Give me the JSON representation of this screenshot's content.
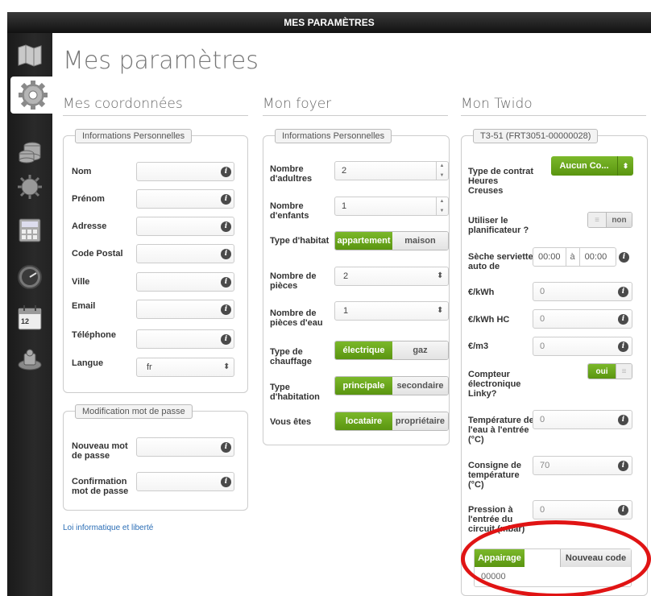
{
  "header": {
    "title": "MES PARAMÈTRES"
  },
  "sidebar": {
    "items": [
      "map-icon",
      "gear-icon",
      "coins-icon",
      "sun-icon",
      "calculator-icon",
      "gauge-icon",
      "calendar-icon",
      "puzzle-icon"
    ],
    "calendar_day": "12"
  },
  "page": {
    "title": "Mes paramètres"
  },
  "columns": {
    "coordonnees": "Mes coordonnées",
    "foyer": "Mon foyer",
    "twido": "Mon Twido"
  },
  "coordonnees": {
    "legend": "Informations Personnelles",
    "nom": "Nom",
    "prenom": "Prénom",
    "adresse": "Adresse",
    "code_postal": "Code Postal",
    "ville": "Ville",
    "email": "Email",
    "telephone": "Téléphone",
    "langue": "Langue",
    "langue_value": "fr"
  },
  "password": {
    "legend": "Modification mot de passe",
    "nouveau": "Nouveau mot de passe",
    "confirmation": "Confirmation mot de passe"
  },
  "link": "Loi informatique et liberté",
  "foyer": {
    "legend": "Informations Personnelles",
    "adultes_label": "Nombre d'adultres",
    "adultes_value": "2",
    "enfants_label": "Nombre d'enfants",
    "enfants_value": "1",
    "habitat_label": "Type d'habitat",
    "habitat_on": "appartement",
    "habitat_off": "maison",
    "pieces_label": "Nombre de pièces",
    "pieces_value": "2",
    "pieces_eau_label": "Nombre de pièces d'eau",
    "pieces_eau_value": "1",
    "chauffage_label": "Type de chauffage",
    "chauffage_on": "électrique",
    "chauffage_off": "gaz",
    "habitation_label": "Type d'habitation",
    "habitation_on": "principale",
    "habitation_off": "secondaire",
    "vous_label": "Vous êtes",
    "vous_on": "locataire",
    "vous_off": "propriétaire"
  },
  "twido": {
    "legend": "T3-51 (FRT3051-00000028)",
    "contrat_label": "Type de contrat Heures Creuses",
    "contrat_value": "Aucun Co...",
    "planif_label": "Utiliser le planificateur ?",
    "planif_value": "non",
    "seche_label": "Sèche serviette auto de",
    "seche_from": "00:00",
    "seche_sep": "à",
    "seche_to": "00:00",
    "kwh_label": "€/kWh",
    "kwh_value": "0",
    "kwh_hc_label": "€/kWh HC",
    "kwh_hc_value": "0",
    "m3_label": "€/m3",
    "m3_value": "0",
    "linky_label": "Compteur électronique Linky?",
    "linky_value": "oui",
    "temp_label": "Température de l'eau à l'entrée (°C)",
    "temp_value": "0",
    "consigne_label": "Consigne de température (°C)",
    "consigne_value": "70",
    "pression_label": "Pression à l'entrée du circuit (mbar)",
    "pression_value": "0",
    "appairage": "Appairage",
    "nouveau_code": "Nouveau code",
    "code_value": "00000"
  },
  "colors": {
    "accent_green": "#6aa61d",
    "annotation_red": "#e01414"
  }
}
